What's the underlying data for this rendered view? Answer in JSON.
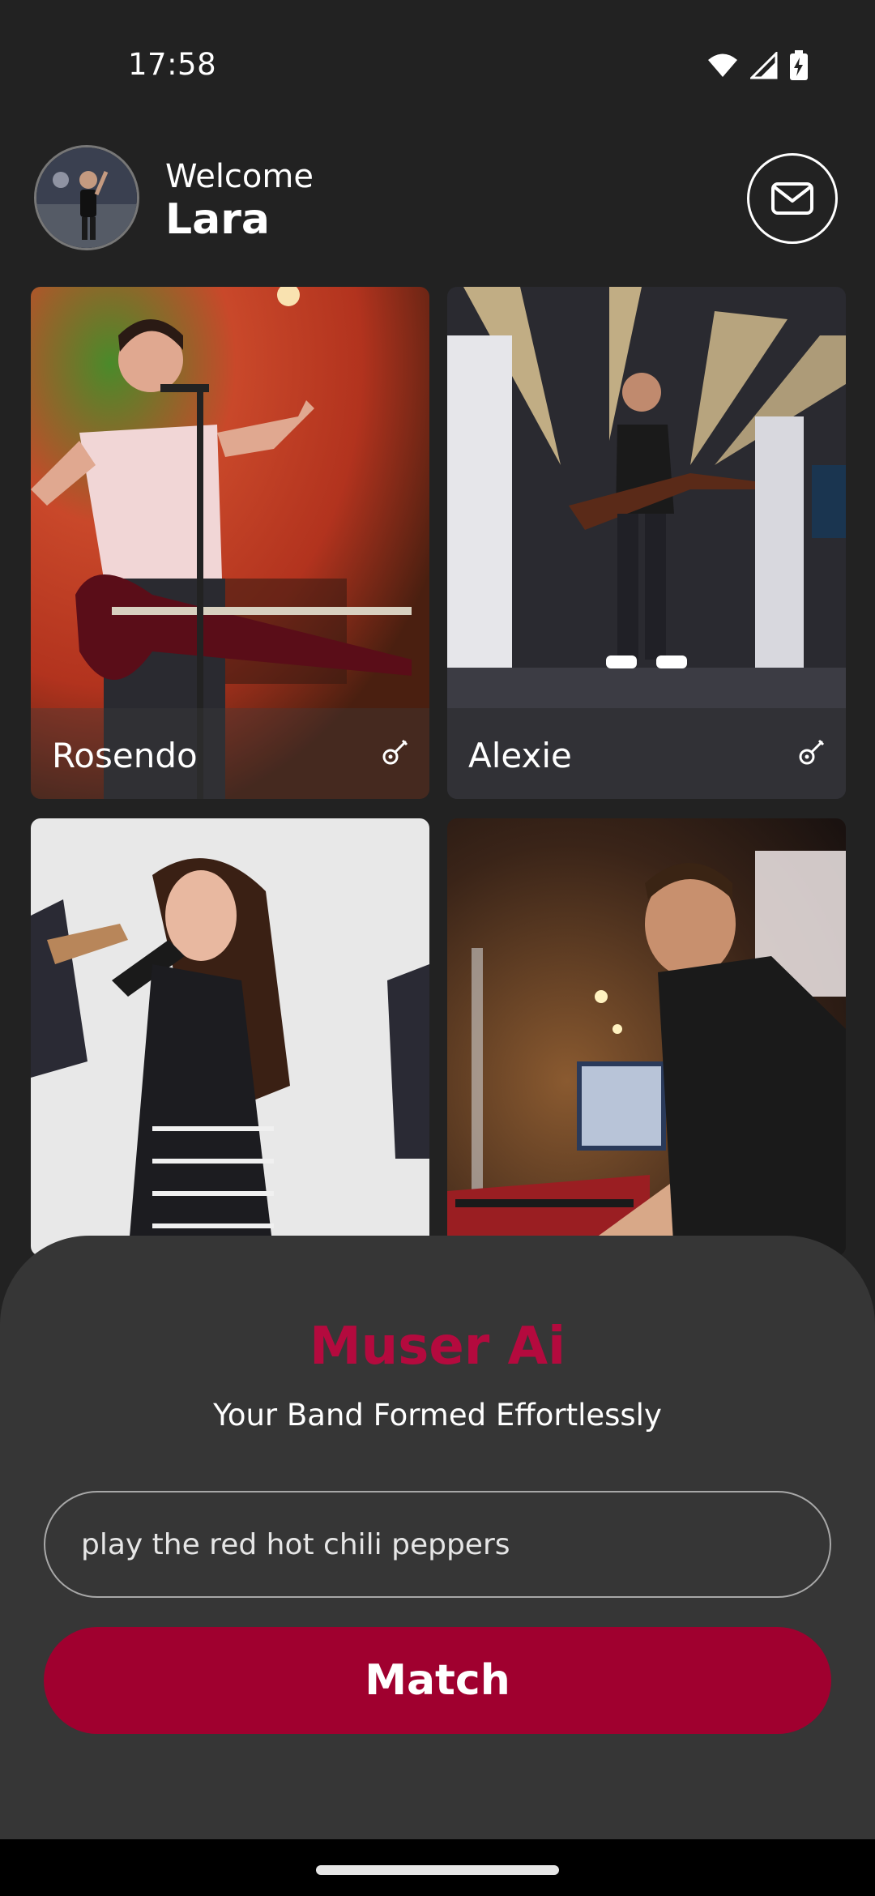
{
  "status_bar": {
    "time": "17:58",
    "icons": [
      "wifi-icon",
      "cell-signal-icon",
      "battery-charging-icon"
    ]
  },
  "header": {
    "welcome_label": "Welcome",
    "user_name": "Lara",
    "avatar_icon": "user-avatar",
    "mail_icon": "mail-icon"
  },
  "musicians": [
    {
      "name": "Rosendo",
      "instrument_icon": "guitar-icon"
    },
    {
      "name": "Alexie",
      "instrument_icon": "guitar-icon"
    },
    {
      "name": "",
      "instrument_icon": ""
    },
    {
      "name": "",
      "instrument_icon": ""
    }
  ],
  "panel": {
    "brand": "Muser Ai",
    "tagline": "Your Band Formed Effortlessly",
    "prompt_value": "play the red hot chili peppers",
    "match_label": "Match"
  },
  "colors": {
    "accent": "#a0002f",
    "brand_text": "#b40a3e",
    "background": "#222222",
    "sheet": "#363636"
  }
}
